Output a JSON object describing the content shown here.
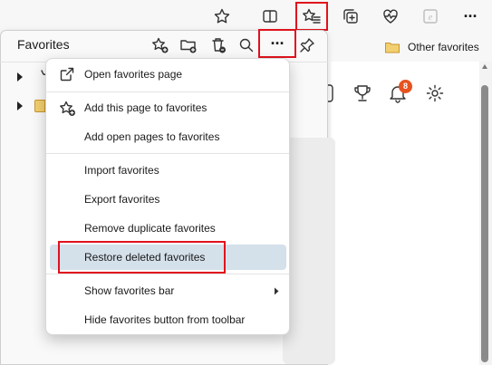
{
  "browser_toolbar": {
    "buttons": [
      {
        "icon": "star-outline-icon"
      },
      {
        "icon": "split-screen-icon"
      },
      {
        "icon": "favorites-icon"
      },
      {
        "icon": "collections-icon"
      },
      {
        "icon": "browser-essentials-icon"
      },
      {
        "icon": "internet-explorer-mode-icon"
      },
      {
        "icon": "more-icon",
        "label": "···"
      }
    ]
  },
  "favorites_bar": {
    "folder_label": "Other favorites"
  },
  "page_toolbar": {
    "notification_count": "8"
  },
  "favorites_panel": {
    "title": "Favorites",
    "header_buttons": [
      {
        "icon": "add-favorite-icon"
      },
      {
        "icon": "add-folder-icon"
      },
      {
        "icon": "delete-favorites-icon"
      },
      {
        "icon": "search-icon"
      },
      {
        "icon": "more-options-icon",
        "label": "···"
      },
      {
        "icon": "pin-icon"
      }
    ]
  },
  "context_menu": {
    "items": [
      {
        "label": "Open favorites page",
        "icon": "open-external-icon"
      },
      {
        "label": "Add this page to favorites",
        "icon": "star-add-icon"
      },
      {
        "label": "Add open pages to favorites"
      },
      {
        "label": "Import favorites"
      },
      {
        "label": "Export favorites"
      },
      {
        "label": "Remove duplicate favorites"
      },
      {
        "label": "Restore deleted favorites",
        "selected": true
      },
      {
        "label": "Show favorites bar",
        "submenu": true
      },
      {
        "label": "Hide favorites button from toolbar"
      }
    ]
  },
  "colors": {
    "highlight_red": "#e0121d",
    "selected_item": "#d4e0ea",
    "badge": "#e8521e",
    "folder": "#e8b84a"
  }
}
